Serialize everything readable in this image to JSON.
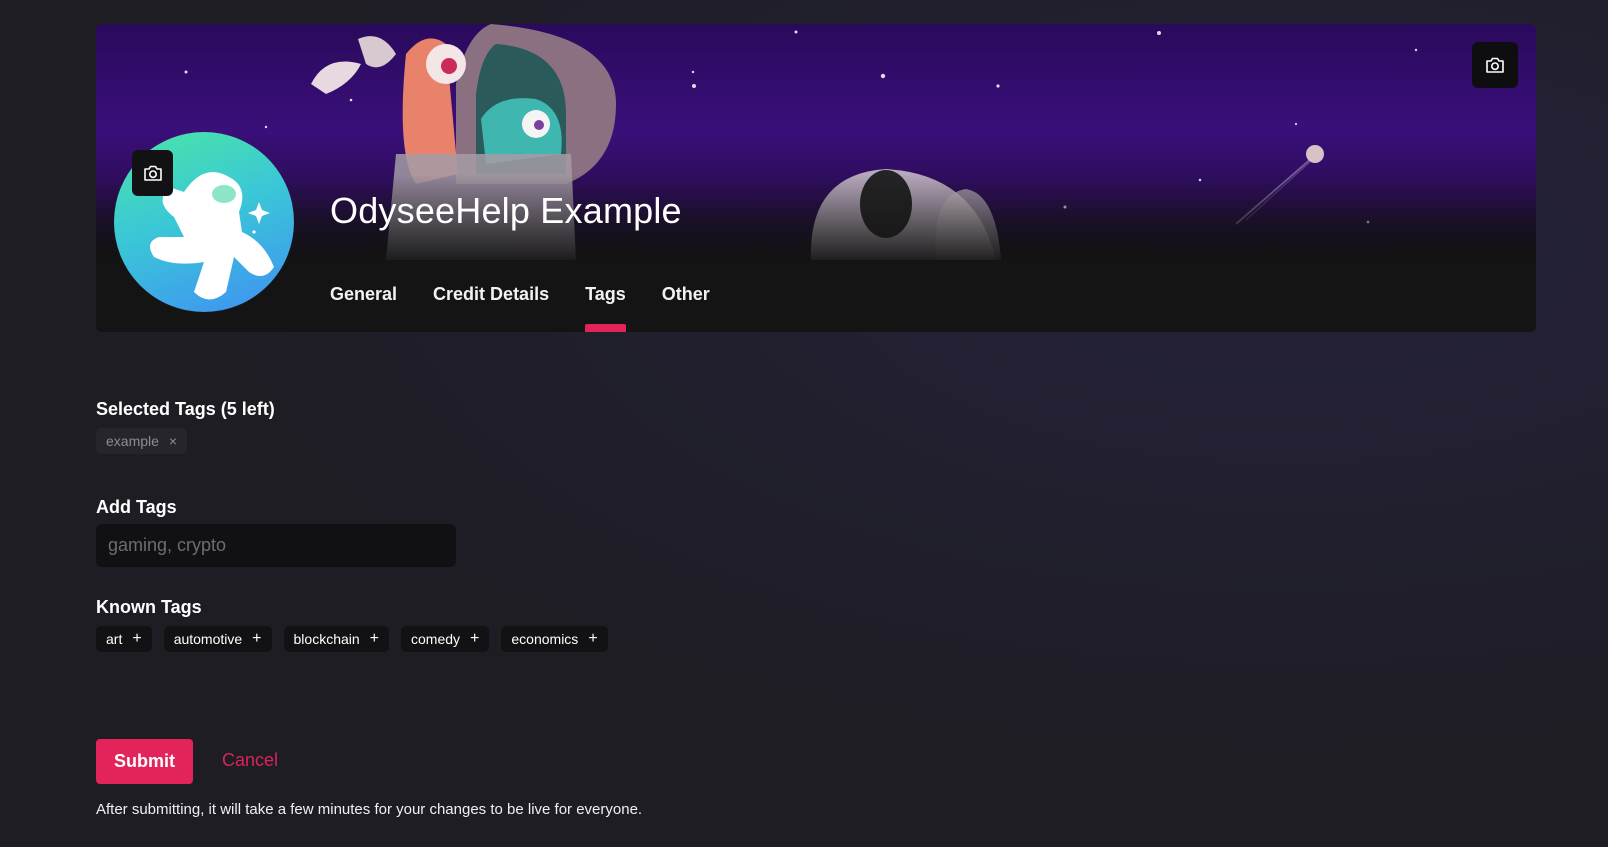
{
  "channel": {
    "title": "OdyseeHelp Example",
    "banner_camera_icon": "camera-icon",
    "avatar_camera_icon": "camera-icon"
  },
  "tabs": [
    {
      "label": "General",
      "active": false
    },
    {
      "label": "Credit Details",
      "active": false
    },
    {
      "label": "Tags",
      "active": true
    },
    {
      "label": "Other",
      "active": false
    }
  ],
  "selected_tags": {
    "title": "Selected Tags (5 left)",
    "items": [
      {
        "label": "example",
        "remove_glyph": "×"
      }
    ]
  },
  "add_tags": {
    "title": "Add Tags",
    "placeholder": "gaming, crypto",
    "value": ""
  },
  "known_tags": {
    "title": "Known Tags",
    "items": [
      {
        "label": "art",
        "add_glyph": "+"
      },
      {
        "label": "automotive",
        "add_glyph": "+"
      },
      {
        "label": "blockchain",
        "add_glyph": "+"
      },
      {
        "label": "comedy",
        "add_glyph": "+"
      },
      {
        "label": "economics",
        "add_glyph": "+"
      }
    ]
  },
  "actions": {
    "submit_label": "Submit",
    "cancel_label": "Cancel",
    "help_text": "After submitting, it will take a few minutes for your changes to be live for everyone."
  },
  "colors": {
    "accent": "#e2245a",
    "background": "#1e1d24",
    "card": "#141414",
    "chip": "#121214",
    "banner_purple": "#3a0f7a"
  }
}
